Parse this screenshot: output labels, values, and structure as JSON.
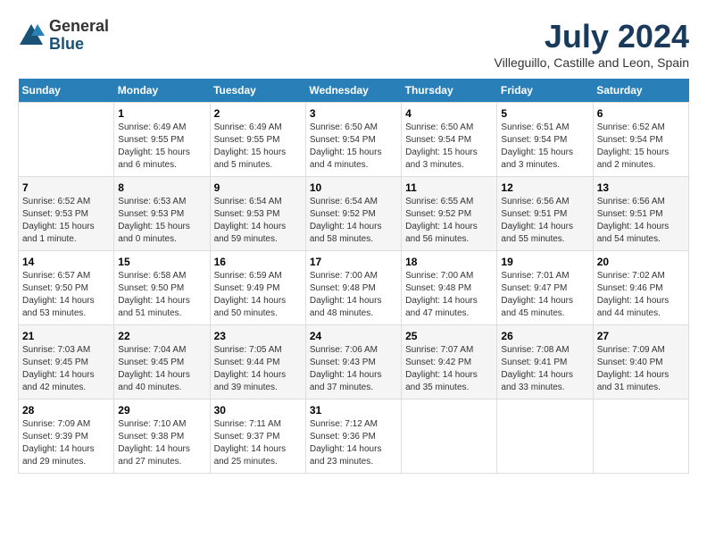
{
  "header": {
    "logo_general": "General",
    "logo_blue": "Blue",
    "month_year": "July 2024",
    "location": "Villeguillo, Castille and Leon, Spain"
  },
  "days_of_week": [
    "Sunday",
    "Monday",
    "Tuesday",
    "Wednesday",
    "Thursday",
    "Friday",
    "Saturday"
  ],
  "weeks": [
    [
      {
        "num": "",
        "info": ""
      },
      {
        "num": "1",
        "info": "Sunrise: 6:49 AM\nSunset: 9:55 PM\nDaylight: 15 hours\nand 6 minutes."
      },
      {
        "num": "2",
        "info": "Sunrise: 6:49 AM\nSunset: 9:55 PM\nDaylight: 15 hours\nand 5 minutes."
      },
      {
        "num": "3",
        "info": "Sunrise: 6:50 AM\nSunset: 9:54 PM\nDaylight: 15 hours\nand 4 minutes."
      },
      {
        "num": "4",
        "info": "Sunrise: 6:50 AM\nSunset: 9:54 PM\nDaylight: 15 hours\nand 3 minutes."
      },
      {
        "num": "5",
        "info": "Sunrise: 6:51 AM\nSunset: 9:54 PM\nDaylight: 15 hours\nand 3 minutes."
      },
      {
        "num": "6",
        "info": "Sunrise: 6:52 AM\nSunset: 9:54 PM\nDaylight: 15 hours\nand 2 minutes."
      }
    ],
    [
      {
        "num": "7",
        "info": "Sunrise: 6:52 AM\nSunset: 9:53 PM\nDaylight: 15 hours\nand 1 minute."
      },
      {
        "num": "8",
        "info": "Sunrise: 6:53 AM\nSunset: 9:53 PM\nDaylight: 15 hours\nand 0 minutes."
      },
      {
        "num": "9",
        "info": "Sunrise: 6:54 AM\nSunset: 9:53 PM\nDaylight: 14 hours\nand 59 minutes."
      },
      {
        "num": "10",
        "info": "Sunrise: 6:54 AM\nSunset: 9:52 PM\nDaylight: 14 hours\nand 58 minutes."
      },
      {
        "num": "11",
        "info": "Sunrise: 6:55 AM\nSunset: 9:52 PM\nDaylight: 14 hours\nand 56 minutes."
      },
      {
        "num": "12",
        "info": "Sunrise: 6:56 AM\nSunset: 9:51 PM\nDaylight: 14 hours\nand 55 minutes."
      },
      {
        "num": "13",
        "info": "Sunrise: 6:56 AM\nSunset: 9:51 PM\nDaylight: 14 hours\nand 54 minutes."
      }
    ],
    [
      {
        "num": "14",
        "info": "Sunrise: 6:57 AM\nSunset: 9:50 PM\nDaylight: 14 hours\nand 53 minutes."
      },
      {
        "num": "15",
        "info": "Sunrise: 6:58 AM\nSunset: 9:50 PM\nDaylight: 14 hours\nand 51 minutes."
      },
      {
        "num": "16",
        "info": "Sunrise: 6:59 AM\nSunset: 9:49 PM\nDaylight: 14 hours\nand 50 minutes."
      },
      {
        "num": "17",
        "info": "Sunrise: 7:00 AM\nSunset: 9:48 PM\nDaylight: 14 hours\nand 48 minutes."
      },
      {
        "num": "18",
        "info": "Sunrise: 7:00 AM\nSunset: 9:48 PM\nDaylight: 14 hours\nand 47 minutes."
      },
      {
        "num": "19",
        "info": "Sunrise: 7:01 AM\nSunset: 9:47 PM\nDaylight: 14 hours\nand 45 minutes."
      },
      {
        "num": "20",
        "info": "Sunrise: 7:02 AM\nSunset: 9:46 PM\nDaylight: 14 hours\nand 44 minutes."
      }
    ],
    [
      {
        "num": "21",
        "info": "Sunrise: 7:03 AM\nSunset: 9:45 PM\nDaylight: 14 hours\nand 42 minutes."
      },
      {
        "num": "22",
        "info": "Sunrise: 7:04 AM\nSunset: 9:45 PM\nDaylight: 14 hours\nand 40 minutes."
      },
      {
        "num": "23",
        "info": "Sunrise: 7:05 AM\nSunset: 9:44 PM\nDaylight: 14 hours\nand 39 minutes."
      },
      {
        "num": "24",
        "info": "Sunrise: 7:06 AM\nSunset: 9:43 PM\nDaylight: 14 hours\nand 37 minutes."
      },
      {
        "num": "25",
        "info": "Sunrise: 7:07 AM\nSunset: 9:42 PM\nDaylight: 14 hours\nand 35 minutes."
      },
      {
        "num": "26",
        "info": "Sunrise: 7:08 AM\nSunset: 9:41 PM\nDaylight: 14 hours\nand 33 minutes."
      },
      {
        "num": "27",
        "info": "Sunrise: 7:09 AM\nSunset: 9:40 PM\nDaylight: 14 hours\nand 31 minutes."
      }
    ],
    [
      {
        "num": "28",
        "info": "Sunrise: 7:09 AM\nSunset: 9:39 PM\nDaylight: 14 hours\nand 29 minutes."
      },
      {
        "num": "29",
        "info": "Sunrise: 7:10 AM\nSunset: 9:38 PM\nDaylight: 14 hours\nand 27 minutes."
      },
      {
        "num": "30",
        "info": "Sunrise: 7:11 AM\nSunset: 9:37 PM\nDaylight: 14 hours\nand 25 minutes."
      },
      {
        "num": "31",
        "info": "Sunrise: 7:12 AM\nSunset: 9:36 PM\nDaylight: 14 hours\nand 23 minutes."
      },
      {
        "num": "",
        "info": ""
      },
      {
        "num": "",
        "info": ""
      },
      {
        "num": "",
        "info": ""
      }
    ]
  ]
}
